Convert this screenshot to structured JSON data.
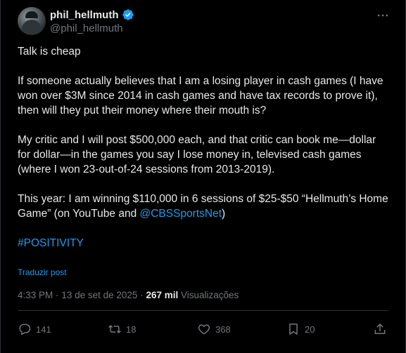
{
  "author": {
    "display_name": "phil_hellmuth",
    "handle": "@phil_hellmuth",
    "verified_icon": "verified-badge-icon",
    "avatar_icon": "avatar-photo"
  },
  "menu": {
    "icon": "more-horizontal-icon"
  },
  "tweet": {
    "line1": "Talk is cheap",
    "para2": "If someone actually believes that I am a losing player in cash games (I have won over $3M since 2014 in cash games and have tax records to prove it), then will they put their money where their mouth is?",
    "para3": "My critic and I will post $500,000 each, and that critic can book me—dollar for dollar—in the games you say I lose money in, televised cash games (where I won 23-out-of-24 sessions from 2013-2019).",
    "para4_prefix": "This year: I am winning $110,000 in 6 sessions of $25-$50 “Hellmuth’s Home Game” (on YouTube and ",
    "para4_mention": "@CBSSportsNet",
    "para4_suffix": ")",
    "hashtag": "#POSITIVITY"
  },
  "translate_label": "Traduzir post",
  "meta": {
    "time": "4:33 PM",
    "separator": "·",
    "date": "13 de set de 2025",
    "views_count": "267 mil",
    "views_label": "Visualizações"
  },
  "actions": {
    "reply": {
      "icon": "reply-icon",
      "count": "141"
    },
    "repost": {
      "icon": "repost-icon",
      "count": "18"
    },
    "like": {
      "icon": "heart-icon",
      "count": "368"
    },
    "bookmark": {
      "icon": "bookmark-icon",
      "count": "20"
    },
    "share": {
      "icon": "share-icon"
    }
  },
  "colors": {
    "background": "#000000",
    "text": "#e7e9ea",
    "muted": "#71767b",
    "accent": "#1d9bf0",
    "divider": "#2f3336"
  }
}
